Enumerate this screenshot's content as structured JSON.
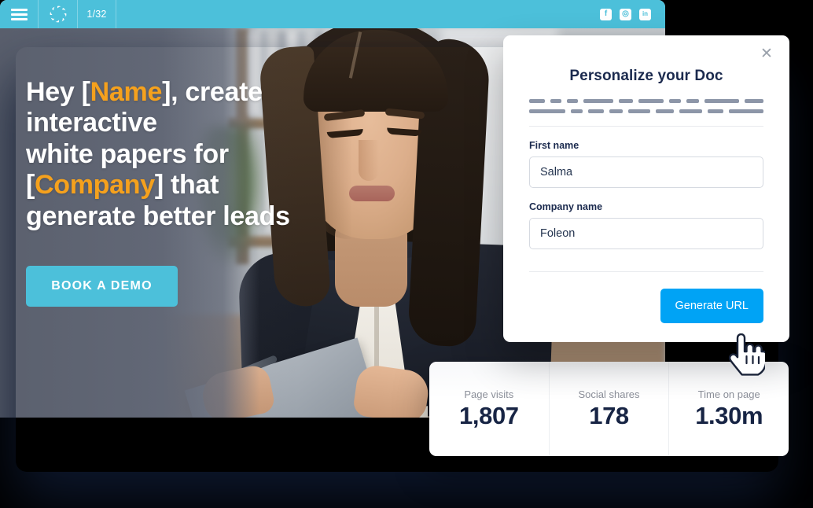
{
  "topbar": {
    "menu_icon": "hamburger-menu-icon",
    "logo_icon": "foleon-aperture-logo-icon",
    "page_indicator": "1/32",
    "social": [
      {
        "name": "facebook-icon",
        "glyph": "f"
      },
      {
        "name": "instagram-icon",
        "glyph": "◎"
      },
      {
        "name": "linkedin-icon",
        "glyph": "in"
      }
    ]
  },
  "hero": {
    "headline": {
      "line1_pre": "Hey [",
      "line1_accent": "Name",
      "line1_post": "], create",
      "line2": "interactive",
      "line3": "white papers for",
      "line4_pre": "[",
      "line4_accent": "Company",
      "line4_post": "] that",
      "line5": "generate better leads"
    },
    "cta_label": "BOOK A DEMO"
  },
  "modal": {
    "title": "Personalize your Doc",
    "close_label": "✕",
    "skeleton_row1": [
      38,
      26,
      26,
      72,
      34,
      60,
      30,
      30,
      82,
      46
    ],
    "skeleton_row2": [
      80,
      26,
      34,
      30,
      48,
      40,
      50,
      34,
      76
    ],
    "fields": [
      {
        "label": "First name",
        "value": "Salma",
        "placeholder": "First name"
      },
      {
        "label": "Company name",
        "value": "Foleon",
        "placeholder": "Company name"
      }
    ],
    "submit_label": "Generate URL"
  },
  "stats": [
    {
      "label": "Page visits",
      "value": "1,807"
    },
    {
      "label": "Social shares",
      "value": "178"
    },
    {
      "label": "Time on page",
      "value": "1.30m"
    }
  ],
  "cursor": {
    "icon": "pointing-hand-cursor-icon"
  },
  "colors": {
    "teal_bar": "#4cc0da",
    "accent_orange": "#f5a11d",
    "button_blue": "#00a3f5",
    "navy_text": "#172444",
    "overlay_grey": "#686e7d"
  }
}
